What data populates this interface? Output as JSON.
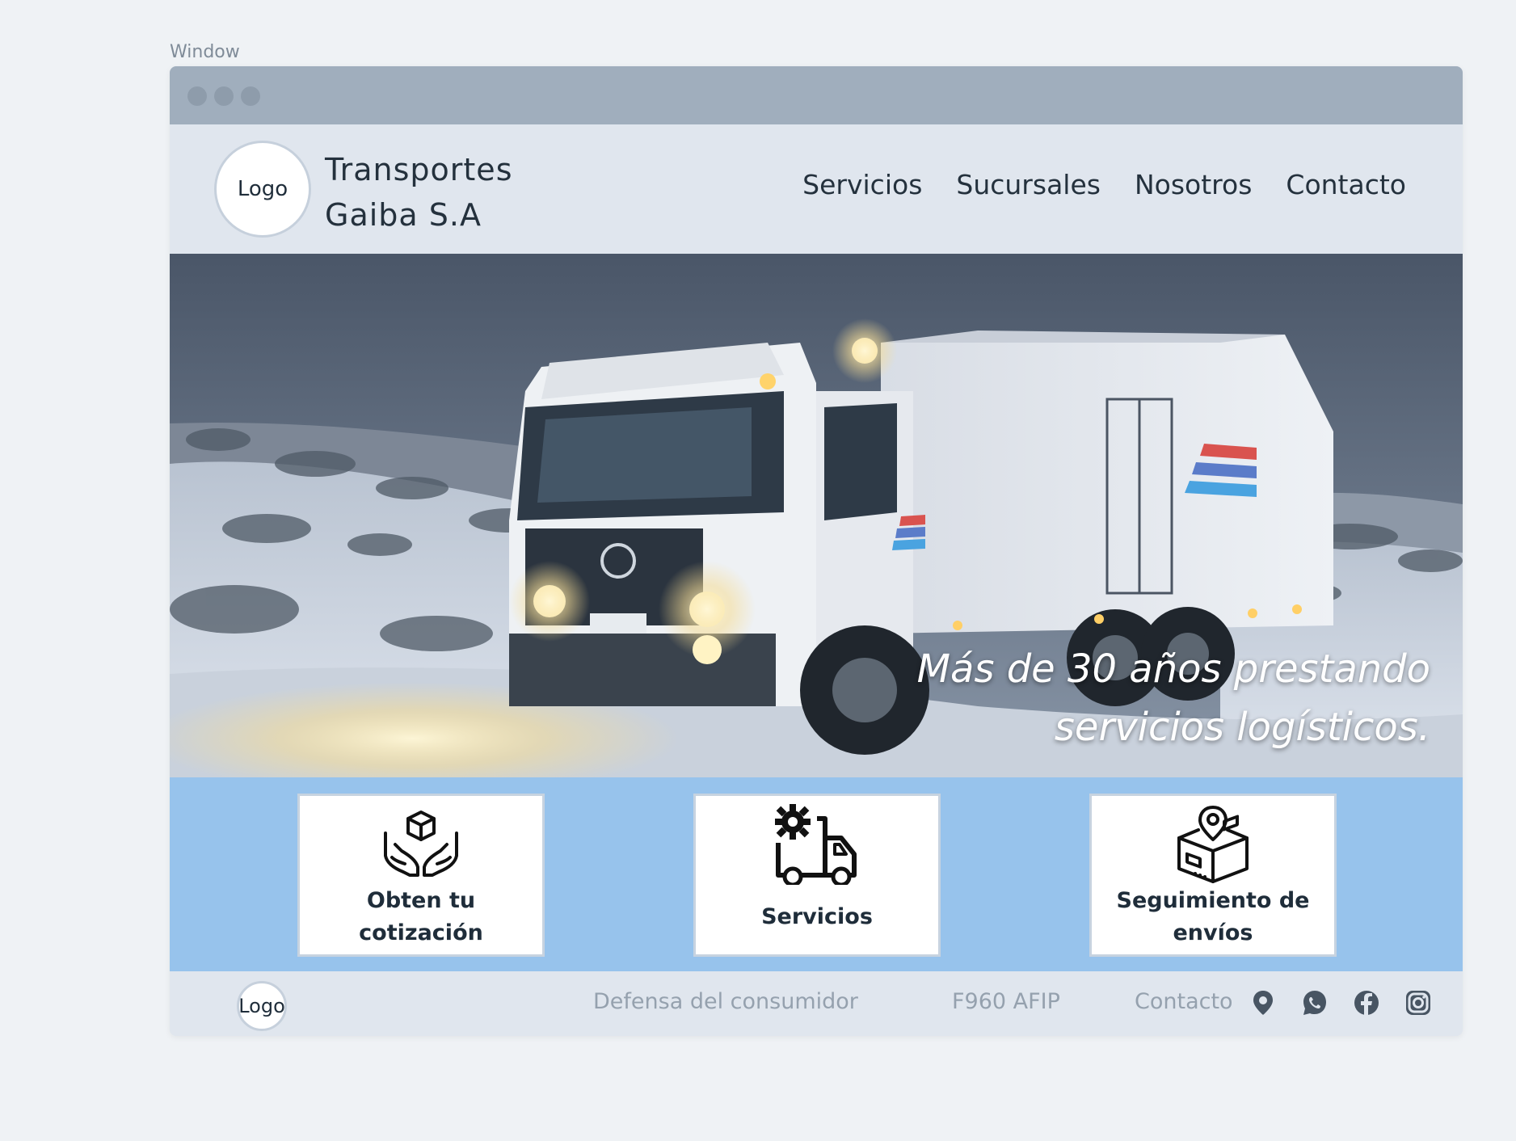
{
  "window": {
    "label": "Window"
  },
  "header": {
    "logo_text": "Logo",
    "brand_line1": "Transportes",
    "brand_line2": "Gaiba S.A",
    "nav": [
      "Servicios",
      "Sucursales",
      "Nosotros",
      "Contacto"
    ]
  },
  "hero": {
    "line1": "Más de 30 años prestando",
    "line2": "servicios logísticos."
  },
  "cards": [
    {
      "label_line1": "Obten tu",
      "label_line2": "cotización",
      "icon": "hands-box-icon"
    },
    {
      "label_line1": "Servicios",
      "label_line2": "",
      "icon": "truck-gear-icon"
    },
    {
      "label_line1": "Seguimiento de",
      "label_line2": "envíos",
      "icon": "box-location-icon"
    }
  ],
  "footer": {
    "logo_text": "Logo",
    "links": [
      "Defensa del consumidor",
      "F960 AFIP",
      "Contacto"
    ],
    "icons": [
      "location-pin-icon",
      "whatsapp-icon",
      "facebook-icon",
      "instagram-icon"
    ]
  },
  "colors": {
    "band": "#97c3ec",
    "header_bg": "#e0e6ee",
    "titlebar": "#a0aebd"
  }
}
